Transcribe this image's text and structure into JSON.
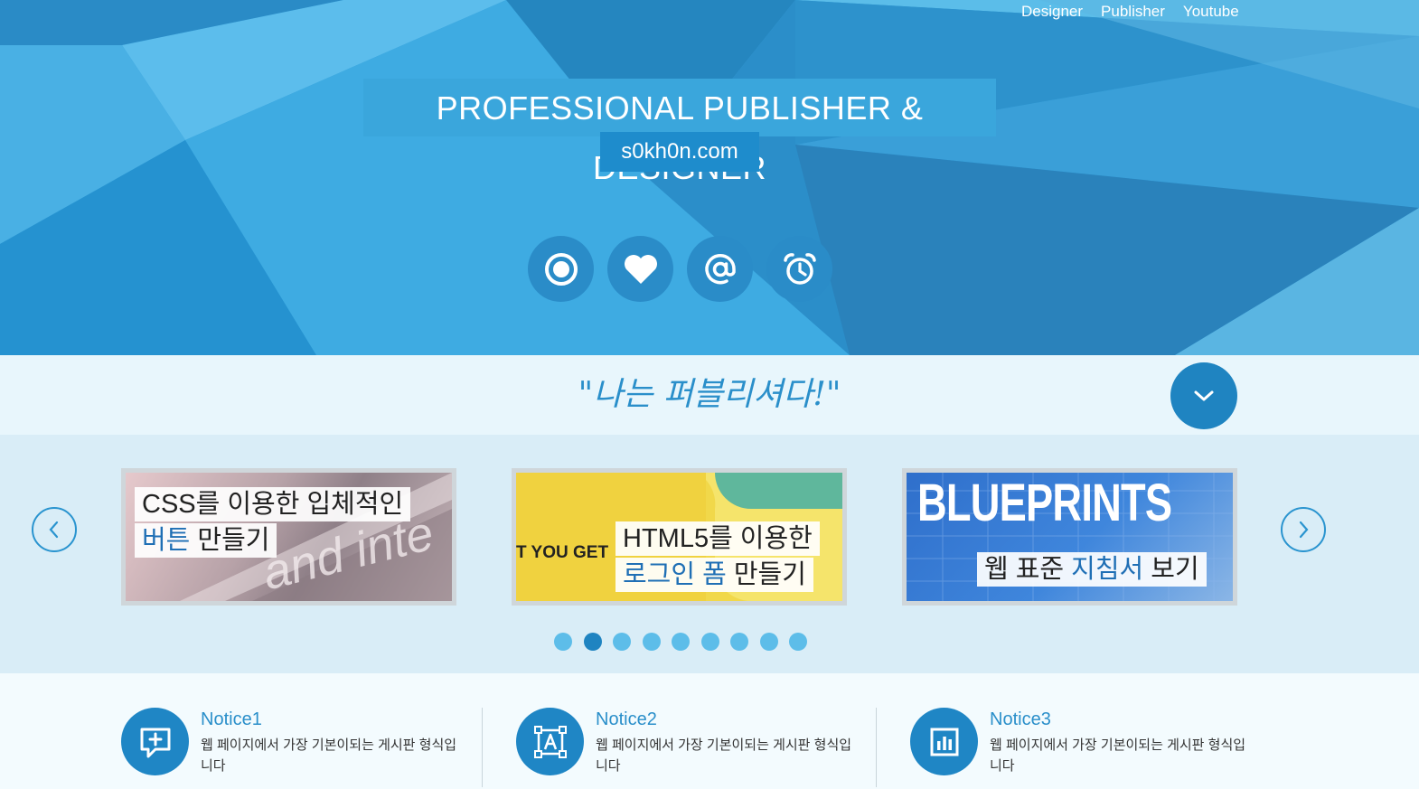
{
  "nav": {
    "items": [
      "Designer",
      "Publisher",
      "Youtube"
    ]
  },
  "hero": {
    "title": "PROFESSIONAL PUBLISHER & DESIGNER",
    "subtitle": "s0kh0n.com",
    "icons": [
      "record-icon",
      "heart-icon",
      "at-sign-icon",
      "alarm-clock-icon"
    ]
  },
  "band": {
    "slogan": "\"나는 퍼블리셔다!\""
  },
  "slides": [
    {
      "line1": "CSS를 이용한 입체적인",
      "line2_hl": "버튼",
      "line2": " 만들기",
      "bg_text": "and inte"
    },
    {
      "line1": "HTML5를 이용한",
      "line2_hl": "로그인 폼",
      "line2": " 만들기",
      "bg_text": "T YOU GET"
    },
    {
      "heading": "BLUEPRINTS",
      "line1_a": "웹 표준 ",
      "line1_hl": "지침서",
      "line1_b": " 보기"
    }
  ],
  "pagination": {
    "count": 9,
    "active": 2
  },
  "notices": [
    {
      "title": "Notice1",
      "desc": "웹 페이지에서 가장 기본이되는 게시판 형식입니다",
      "icon": "add-comment-icon"
    },
    {
      "title": "Notice2",
      "desc": "웹 페이지에서 가장 기본이되는 게시판 형식입니다",
      "icon": "text-frame-icon"
    },
    {
      "title": "Notice3",
      "desc": "웹 페이지에서 가장 기본이되는 게시판 형식입니다",
      "icon": "bar-chart-icon"
    }
  ],
  "colors": {
    "primary": "#1f84c1",
    "light": "#5dbde9",
    "band": "#e8f6fc"
  }
}
